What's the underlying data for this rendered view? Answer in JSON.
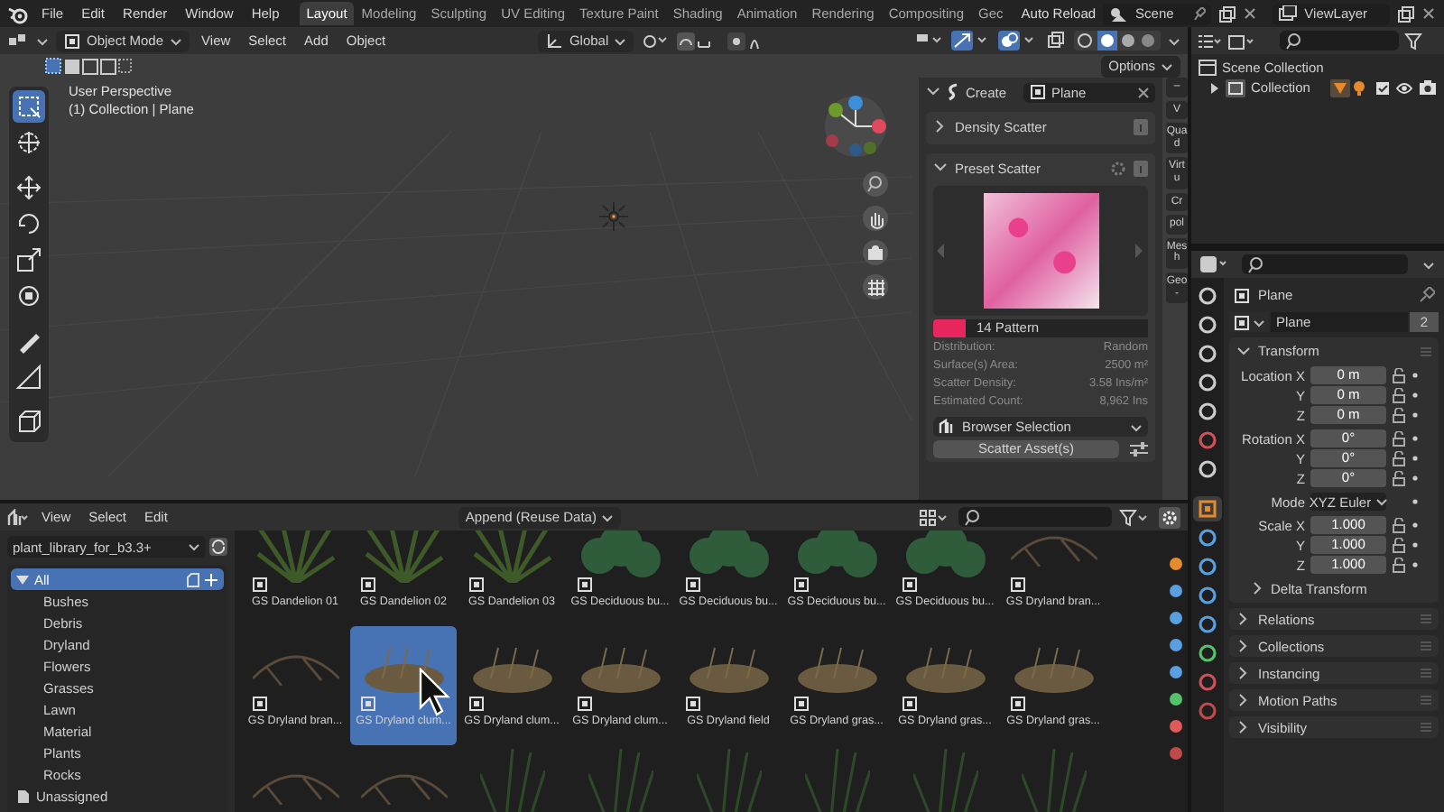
{
  "topbar": {
    "menus": [
      "File",
      "Edit",
      "Render",
      "Window",
      "Help"
    ],
    "workspaces": [
      {
        "label": "Layout",
        "selected": true
      },
      {
        "label": "Modeling",
        "selected": false
      },
      {
        "label": "Sculpting",
        "selected": false
      },
      {
        "label": "UV Editing",
        "selected": false
      },
      {
        "label": "Texture Paint",
        "selected": false
      },
      {
        "label": "Shading",
        "selected": false
      },
      {
        "label": "Animation",
        "selected": false
      },
      {
        "label": "Rendering",
        "selected": false
      },
      {
        "label": "Compositing",
        "selected": false
      },
      {
        "label": "Gec",
        "selected": false
      }
    ],
    "auto_reload": "Auto Reload",
    "scene": "Scene",
    "view_layer": "ViewLayer"
  },
  "viewport": {
    "mode": "Object Mode",
    "menus": [
      "View",
      "Select",
      "Add",
      "Object"
    ],
    "orientation": "Global",
    "options": "Options",
    "info": [
      "User Perspective",
      "(1) Collection | Plane"
    ],
    "tools": [
      {
        "selected": true
      },
      {
        "selected": false
      },
      {
        "selected": false
      },
      {
        "selected": false
      },
      {
        "selected": false
      },
      {
        "selected": false
      },
      {
        "selected": false
      },
      {
        "selected": false
      },
      {
        "selected": false
      }
    ]
  },
  "scatter": {
    "title": "Create",
    "target": "Plane",
    "sections": [
      {
        "label": "Density Scatter",
        "expanded": false
      },
      {
        "label": "Preset Scatter",
        "expanded": true
      }
    ],
    "preset": "14 Pattern",
    "stats": [
      {
        "label": "Distribution:",
        "value": "Random"
      },
      {
        "label": "Surface(s) Area:",
        "value": "2500 m²"
      },
      {
        "label": "Scatter Density:",
        "value": "3.58 Ins/m²"
      },
      {
        "label": "Estimated Count:",
        "value": "8,962 Ins"
      }
    ],
    "selection": "Browser Selection",
    "button": "Scatter Asset(s)",
    "side_tabs": [
      "–",
      "V",
      "Quad",
      "Virtu",
      "Cr",
      "pol",
      "Mesh",
      "Geo-"
    ]
  },
  "outliner": {
    "items": [
      {
        "label": "Scene Collection",
        "children": [
          {
            "label": "Collection",
            "expanded": false
          }
        ]
      }
    ]
  },
  "properties": {
    "tabs": [
      {
        "selected": false
      },
      {
        "selected": false
      },
      {
        "selected": false
      },
      {
        "selected": false
      },
      {
        "selected": false
      },
      {
        "selected": false
      },
      {
        "selected": false
      },
      {
        "selected": true
      },
      {
        "selected": false
      },
      {
        "selected": false
      },
      {
        "selected": false
      },
      {
        "selected": false
      },
      {
        "selected": false
      },
      {
        "selected": false
      },
      {
        "selected": false
      }
    ],
    "object": "Plane",
    "data": "Plane",
    "users": "2",
    "transform": {
      "label": "Transform",
      "expanded": true,
      "groups": [
        [
          {
            "kind": "number",
            "label": "Location X",
            "value": "0 m"
          },
          {
            "kind": "number",
            "label": "Y",
            "value": "0 m"
          },
          {
            "kind": "number",
            "label": "Z",
            "value": "0 m"
          }
        ],
        [
          {
            "kind": "number",
            "label": "Rotation X",
            "value": "0°"
          },
          {
            "kind": "number",
            "label": "Y",
            "value": "0°"
          },
          {
            "kind": "number",
            "label": "Z",
            "value": "0°"
          }
        ],
        [
          {
            "kind": "dropdown",
            "label": "Mode",
            "value": "XYZ Euler"
          }
        ],
        [
          {
            "kind": "number",
            "label": "Scale X",
            "value": "1.000"
          },
          {
            "kind": "number",
            "label": "Y",
            "value": "1.000"
          },
          {
            "kind": "number",
            "label": "Z",
            "value": "1.000"
          }
        ]
      ],
      "subpanels": [
        {
          "label": "Delta Transform",
          "expanded": false
        }
      ]
    },
    "panels": [
      {
        "label": "Relations",
        "expanded": false
      },
      {
        "label": "Collections",
        "expanded": false
      },
      {
        "label": "Instancing",
        "expanded": false
      },
      {
        "label": "Motion Paths",
        "expanded": false
      },
      {
        "label": "Visibility",
        "expanded": false
      }
    ]
  },
  "asset_browser": {
    "menus": [
      "View",
      "Select",
      "Edit"
    ],
    "import_method": "Append (Reuse Data)",
    "library": "plant_library_for_b3.3+",
    "catalogs": [
      {
        "label": "All",
        "selected": true,
        "expanded": true,
        "children": [
          {
            "label": "Bushes",
            "selected": false
          },
          {
            "label": "Debris",
            "selected": false
          },
          {
            "label": "Dryland",
            "selected": false
          },
          {
            "label": "Flowers",
            "selected": false
          },
          {
            "label": "Grasses",
            "selected": false
          },
          {
            "label": "Lawn",
            "selected": false
          },
          {
            "label": "Material",
            "selected": false
          },
          {
            "label": "Plants",
            "selected": false
          },
          {
            "label": "Rocks",
            "selected": false
          }
        ]
      },
      {
        "label": "Unassigned",
        "selected": false
      }
    ],
    "assets": [
      {
        "label": "GS Dandelion 01",
        "selected": false
      },
      {
        "label": "GS Dandelion 02",
        "selected": false
      },
      {
        "label": "GS Dandelion 03",
        "selected": false
      },
      {
        "label": "GS Deciduous bu...",
        "selected": false
      },
      {
        "label": "GS Deciduous bu...",
        "selected": false
      },
      {
        "label": "GS Deciduous bu...",
        "selected": false
      },
      {
        "label": "GS Deciduous bu...",
        "selected": false
      },
      {
        "label": "GS Dryland bran...",
        "selected": false
      },
      {
        "label": "GS Dryland bran...",
        "selected": false
      },
      {
        "label": "GS Dryland clum...",
        "selected": true
      },
      {
        "label": "GS Dryland clum...",
        "selected": false
      },
      {
        "label": "GS Dryland clum...",
        "selected": false
      },
      {
        "label": "GS Dryland field",
        "selected": false
      },
      {
        "label": "GS Dryland gras...",
        "selected": false
      },
      {
        "label": "GS Dryland gras...",
        "selected": false
      },
      {
        "label": "GS Dryland gras...",
        "selected": false
      }
    ]
  }
}
